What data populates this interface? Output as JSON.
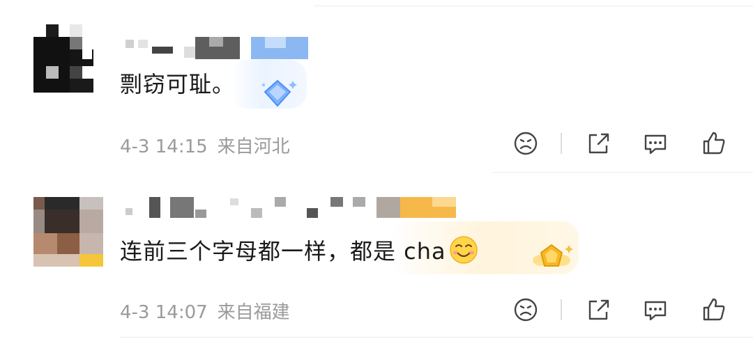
{
  "comments": [
    {
      "text": "剽窃可耻。",
      "time": "4-3 14:15",
      "location": "来自河北",
      "badge_icon": "blue-diamond-badge-icon"
    },
    {
      "text": "连前三个字母都一样，都是 cha",
      "emoji_icon": "smiling-face-icon",
      "time": "4-3 14:07",
      "location": "来自福建",
      "badge_icon": "gold-pentagon-badge-icon"
    }
  ],
  "actions": [
    {
      "icon": "dislike-face-icon"
    },
    {
      "icon": "share-icon"
    },
    {
      "icon": "comment-icon"
    },
    {
      "icon": "thumbs-up-icon"
    }
  ],
  "colors": {
    "text": "#1a1a1a",
    "meta": "#9a9a9a",
    "blue_badge": "#6aa8ff",
    "gold_badge": "#f5b623"
  }
}
